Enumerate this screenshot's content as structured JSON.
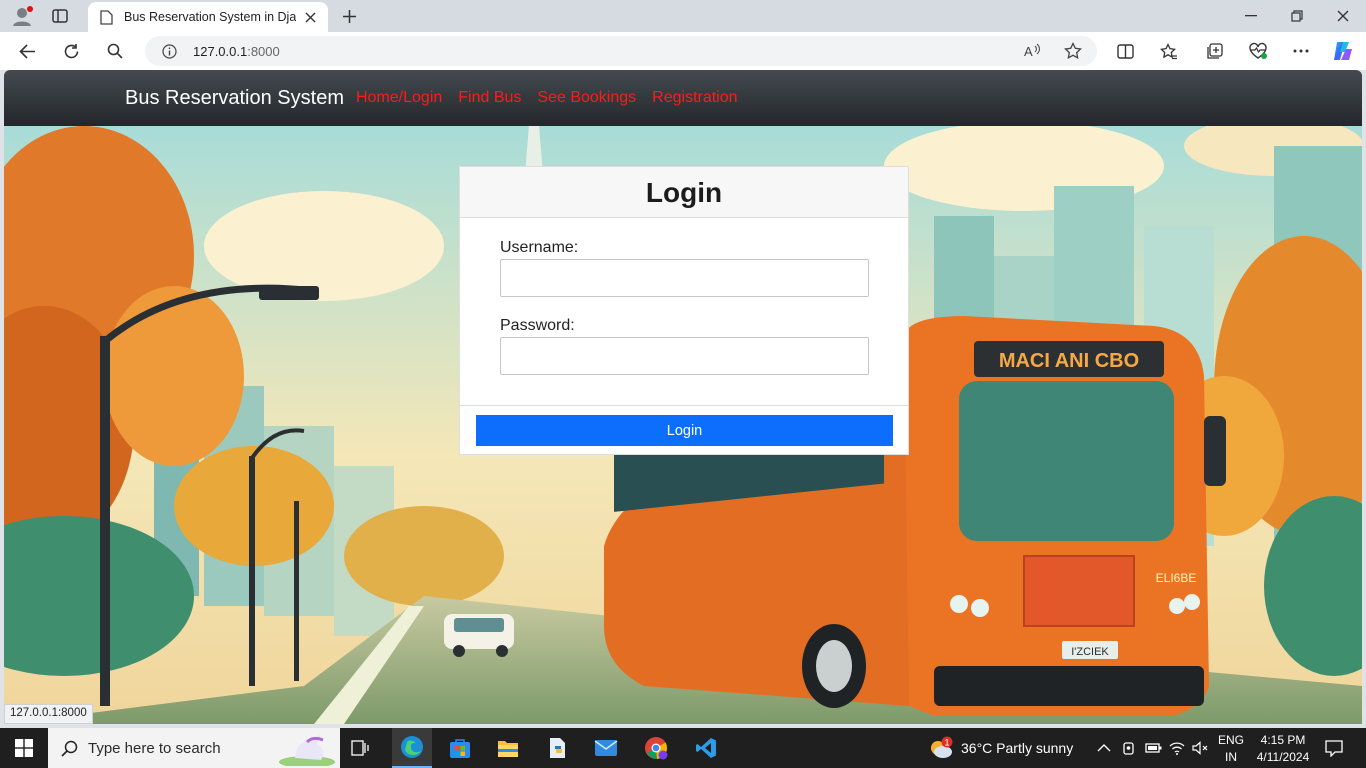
{
  "browser": {
    "tab_title": "Bus Reservation System in Djang",
    "url_host": "127.0.0.1",
    "url_port": ":8000",
    "status_url": "127.0.0.1:8000"
  },
  "navbar": {
    "brand": "Bus Reservation System",
    "links": [
      {
        "label": "Home/Login"
      },
      {
        "label": "Find Bus"
      },
      {
        "label": "See Bookings"
      },
      {
        "label": "Registration"
      }
    ],
    "link_color": "#ff1a1a"
  },
  "login": {
    "title": "Login",
    "username_label": "Username:",
    "username_value": "",
    "password_label": "Password:",
    "password_value": "",
    "button_label": "Login",
    "button_color": "#0d6efd"
  },
  "hero": {
    "bus_sign": "MACI ANI CBO",
    "bus_side_text": "ELI6BE",
    "plate": "I'ZCIEK"
  },
  "taskbar": {
    "search_placeholder": "Type here to search",
    "weather": "36°C  Partly sunny",
    "weather_badge": "1",
    "language": "ENG",
    "region": "IN",
    "time": "4:15 PM",
    "date": "4/11/2024"
  }
}
